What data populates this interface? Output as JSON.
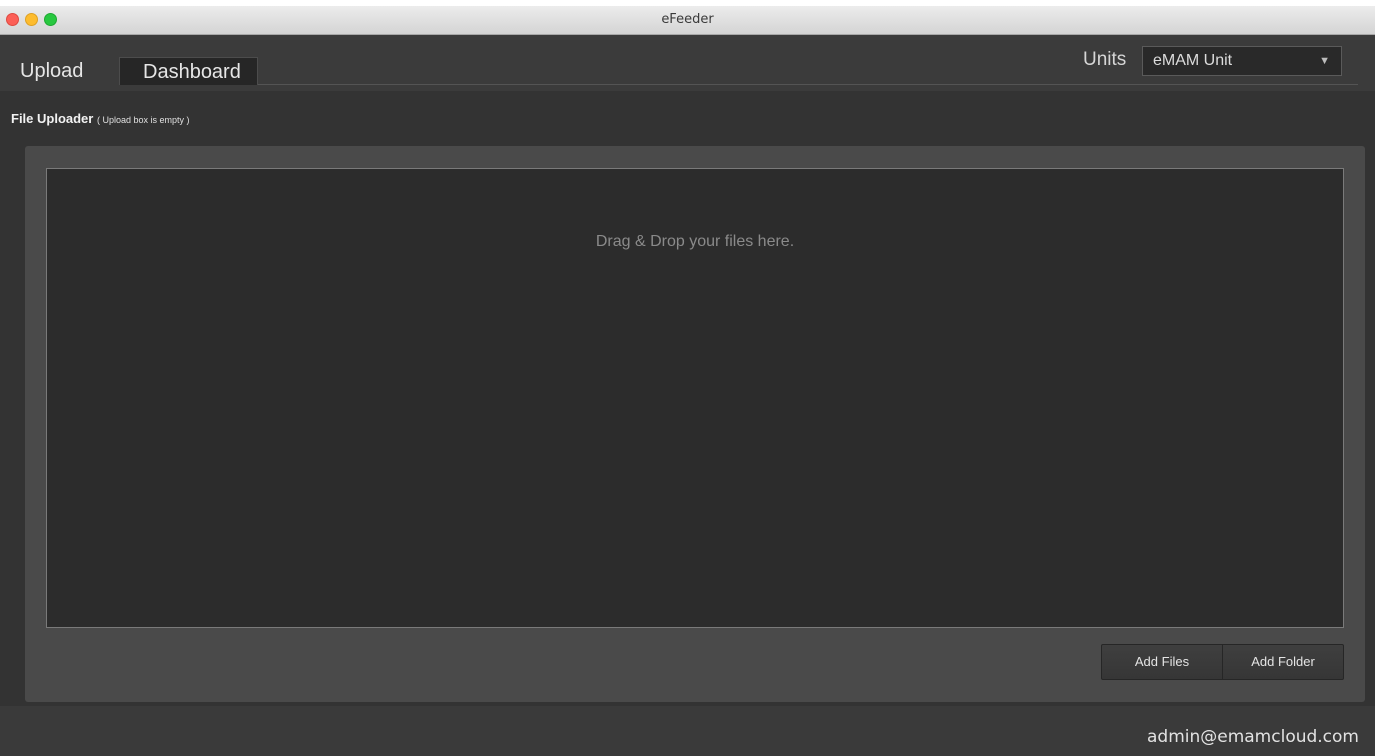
{
  "window": {
    "title": "eFeeder"
  },
  "tabs": [
    {
      "label": "Upload",
      "active": true
    },
    {
      "label": "Dashboard",
      "active": false
    }
  ],
  "units": {
    "label": "Units",
    "selected": "eMAM Unit",
    "caret_icon": "dropdown-caret"
  },
  "uploader": {
    "title": "File Uploader",
    "status": "( Upload box is empty )",
    "drop_hint": "Drag & Drop your files here.",
    "add_files_label": "Add Files",
    "add_folder_label": "Add Folder"
  },
  "footer": {
    "user": "admin@emamcloud.com"
  },
  "colors": {
    "close": "#fc5f57",
    "minimize": "#fdbc2e",
    "maximize": "#28c840",
    "background": "#333333",
    "panel": "#4a4a4a",
    "drop_zone": "#2c2c2c"
  }
}
